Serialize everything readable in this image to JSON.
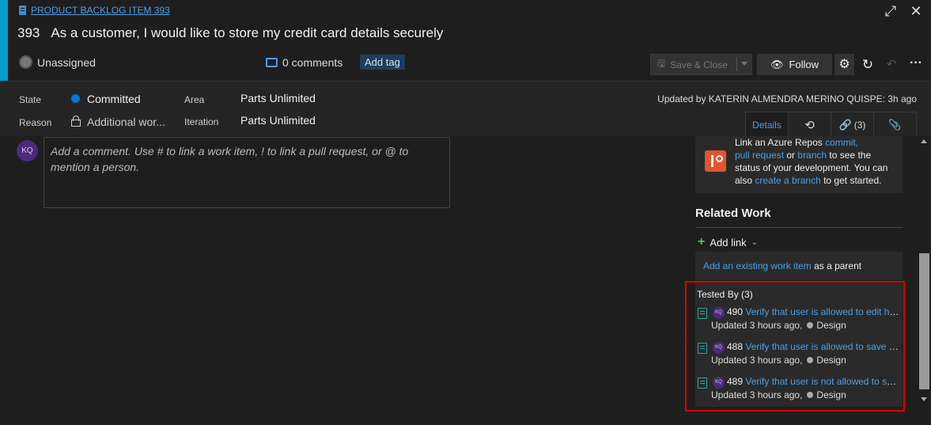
{
  "header": {
    "type_label": "PRODUCT BACKLOG ITEM 393",
    "id": "393",
    "title": "As a customer, I would like to store my credit card details securely",
    "assignee": "Unassigned",
    "comments": "0 comments",
    "add_tag": "Add tag",
    "save_close": "Save & Close",
    "follow": "Follow"
  },
  "fields": {
    "state_label": "State",
    "state_value": "Committed",
    "reason_label": "Reason",
    "reason_value": "Additional wor...",
    "area_label": "Area",
    "area_value": "Parts Unlimited",
    "iteration_label": "Iteration",
    "iteration_value": "Parts Unlimited",
    "updated": "Updated by KATERIN ALMENDRA MERINO QUISPE: 3h ago"
  },
  "tabs": {
    "details": "Details",
    "links_count": "(3)"
  },
  "discussion": {
    "avatar_initials": "KQ",
    "placeholder": "Add a comment. Use # to link a work item, ! to link a pull request, or @ to mention a person."
  },
  "development": {
    "t1": "Link an Azure Repos ",
    "l1": "commit,",
    "l2": "pull request",
    "t2": " or ",
    "l3": "branch",
    "t3": " to see the status of your development. You can also ",
    "l4": "create a branch",
    "t4": " to get started."
  },
  "related_work": {
    "title": "Related Work",
    "add_link": "Add link",
    "parent_link": "Add an existing work item",
    "parent_suffix": " as a parent",
    "tested_by": "Tested By (3)",
    "items": [
      {
        "avatar": "KQ",
        "id": "490",
        "title": "Verify that user is allowed to edit his saved credit card details",
        "updated": "Updated 3 hours ago,",
        "state": "Design"
      },
      {
        "avatar": "KQ",
        "id": "488",
        "title": "Verify that user is allowed to save his credit card details",
        "updated": "Updated 3 hours ago,",
        "state": "Design"
      },
      {
        "avatar": "KQ",
        "id": "489",
        "title": "Verify that user is not allowed to save invalid credit card details",
        "updated": "Updated 3 hours ago,",
        "state": "Design"
      }
    ]
  }
}
